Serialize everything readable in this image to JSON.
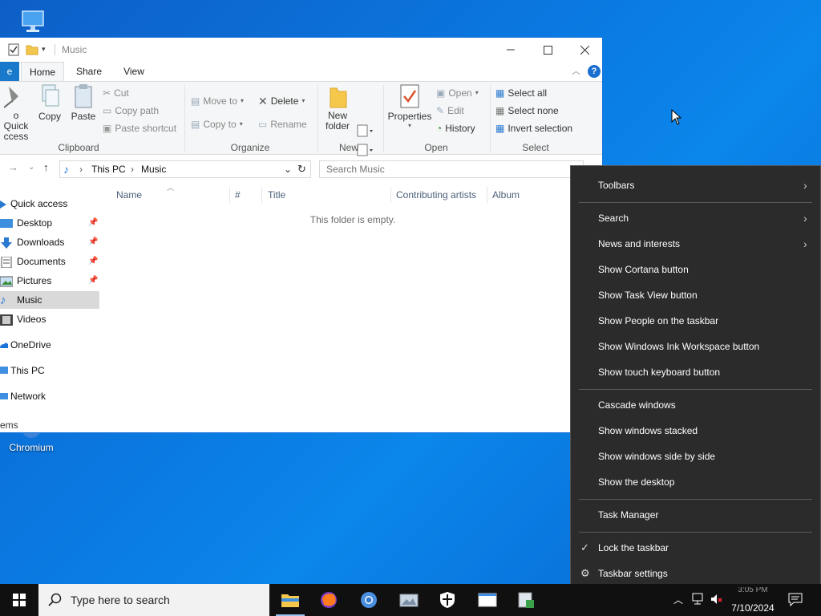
{
  "desktop": {
    "icons": [
      {
        "label": "Chromium"
      }
    ]
  },
  "explorer": {
    "title": "Music",
    "tabs": {
      "file": "e",
      "home": "Home",
      "share": "Share",
      "view": "View"
    },
    "ribbon": {
      "clipboard": {
        "pin_label_1": "o Quick",
        "pin_label_2": "ccess",
        "copy": "Copy",
        "paste": "Paste",
        "cut": "Cut",
        "copy_path": "Copy path",
        "paste_shortcut": "Paste shortcut",
        "group": "Clipboard"
      },
      "organize": {
        "move_to": "Move to",
        "copy_to": "Copy to",
        "delete": "Delete",
        "rename": "Rename",
        "group": "Organize"
      },
      "new": {
        "new_folder_1": "New",
        "new_folder_2": "folder",
        "group": "New"
      },
      "open": {
        "properties": "Properties",
        "open": "Open",
        "edit": "Edit",
        "history": "History",
        "group": "Open"
      },
      "select": {
        "select_all": "Select all",
        "select_none": "Select none",
        "invert": "Invert selection",
        "group": "Select"
      }
    },
    "address": {
      "crumbs": [
        "This PC",
        "Music"
      ],
      "search_placeholder": "Search Music"
    },
    "nav": [
      {
        "label": "Quick access"
      },
      {
        "label": "Desktop",
        "pinned": true
      },
      {
        "label": "Downloads",
        "pinned": true
      },
      {
        "label": "Documents",
        "pinned": true
      },
      {
        "label": "Pictures",
        "pinned": true
      },
      {
        "label": "Music",
        "selected": true
      },
      {
        "label": "Videos"
      },
      {
        "label": "OneDrive"
      },
      {
        "label": "This PC"
      },
      {
        "label": "Network"
      }
    ],
    "columns": [
      "Name",
      "#",
      "Title",
      "Contributing artists",
      "Album"
    ],
    "empty_message": "This folder is empty.",
    "status": "ems"
  },
  "context_menu": {
    "items": [
      {
        "label": "Toolbars",
        "submenu": true
      },
      {
        "label": "Search",
        "submenu": true
      },
      {
        "label": "News and interests",
        "submenu": true
      },
      {
        "label": "Show Cortana button"
      },
      {
        "label": "Show Task View button"
      },
      {
        "label": "Show People on the taskbar"
      },
      {
        "label": "Show Windows Ink Workspace button"
      },
      {
        "label": "Show touch keyboard button"
      },
      {
        "label": "Cascade windows"
      },
      {
        "label": "Show windows stacked"
      },
      {
        "label": "Show windows side by side"
      },
      {
        "label": "Show the desktop"
      },
      {
        "label": "Task Manager"
      },
      {
        "label": "Lock the taskbar",
        "checked": true
      },
      {
        "label": "Taskbar settings",
        "icon": "gear-icon"
      }
    ]
  },
  "taskbar": {
    "search_placeholder": "Type here to search",
    "apps": [
      "file-explorer-icon",
      "firefox-icon",
      "chromium-icon",
      "photos-icon",
      "security-icon",
      "window-icon",
      "app-icon"
    ],
    "clock": {
      "time": "3:05 PM",
      "date": "7/10/2024"
    }
  }
}
